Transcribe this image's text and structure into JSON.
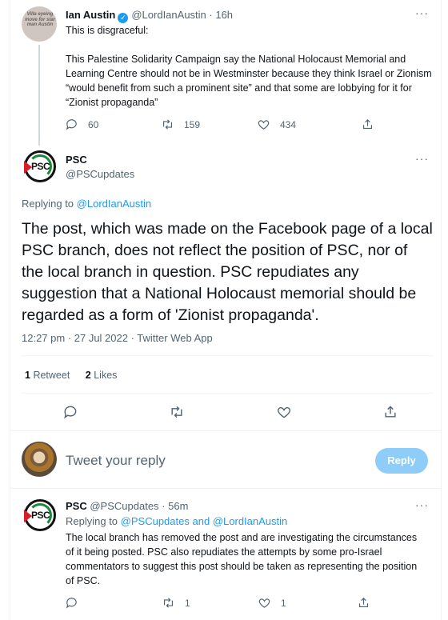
{
  "parent": {
    "avatar_text": "Villa eyeing move for star man Austin",
    "name": "Ian Austin",
    "handle": "@LordIanAustin",
    "time": "· 16h",
    "line1": "This is disgraceful:",
    "line2": "This Palestine Solidarity Campaign say the National Holocaust Memorial and Learning Centre should not be in Westminster because they think Israel or Zionism “would benefit from such a prominent site” and that some are lobbying for it for “Zionist propaganda”",
    "replies": "60",
    "retweets": "159",
    "likes": "434"
  },
  "main": {
    "avatar_text": "PSC",
    "name": "PSC",
    "handle": "@PSCupdates",
    "replying_prefix": "Replying to",
    "replying_handle": "@LordIanAustin",
    "text": "The post, which was made on the Facebook page of a local PSC branch, does not reflect the position of PSC, nor of the local branch in question. PSC repudiates any suggestion that a National Holocaust memorial should be regarded as a form of 'Zionist propaganda'.",
    "meta": "12:27 pm · 27 Jul 2022 · Twitter Web App",
    "retweet_count": "1",
    "retweet_label": "Retweet",
    "likes_count": "2",
    "likes_label": "Likes"
  },
  "compose": {
    "placeholder": "Tweet your reply",
    "button": "Reply"
  },
  "reply": {
    "avatar_text": "PSC",
    "name": "PSC",
    "handle": "@PSCupdates",
    "time": "· 56m",
    "replying_prefix": "Replying to",
    "replying_handle1": "@PSCupdates",
    "replying_and": "and",
    "replying_handle2": "@LordIanAustin",
    "text": "The local branch has removed the post and are investigating the circumstances of it being posted. PSC also repudiates the attempts by some pro-Israel commentators to suggest this post should be taken as representing the position of PSC.",
    "retweets": "1",
    "likes": "1"
  },
  "icons": {
    "verified": "verified-badge-icon",
    "reply": "reply-icon",
    "retweet": "retweet-icon",
    "like": "heart-icon",
    "share": "share-icon",
    "more": "more-icon"
  },
  "colors": {
    "accent": "#1d9bf0",
    "muted": "#536471",
    "reply_button": "#8ecdf8"
  }
}
